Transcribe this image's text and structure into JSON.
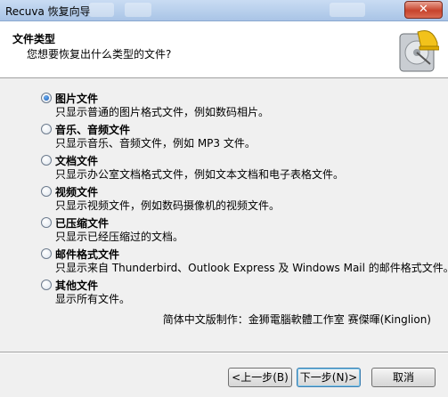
{
  "window": {
    "title": "Recuva 恢复向导",
    "close_label": "✕"
  },
  "header": {
    "title": "文件类型",
    "subtitle": "您想要恢复出什么类型的文件?"
  },
  "options": [
    {
      "label": "图片文件",
      "desc": "只显示普通的图片格式文件，例如数码相片。",
      "checked": true
    },
    {
      "label": "音乐、音频文件",
      "desc": "只显示音乐、音频文件，例如 MP3 文件。",
      "checked": false
    },
    {
      "label": "文档文件",
      "desc": "只显示办公室文档格式文件，例如文本文档和电子表格文件。",
      "checked": false
    },
    {
      "label": "视频文件",
      "desc": "只显示视频文件，例如数码摄像机的视频文件。",
      "checked": false
    },
    {
      "label": "已压缩文件",
      "desc": "只显示已经压缩过的文档。",
      "checked": false
    },
    {
      "label": "邮件格式文件",
      "desc": "只显示来自 Thunderbird、Outlook Express 及 Windows Mail 的邮件格式文件。",
      "checked": false
    },
    {
      "label": "其他文件",
      "desc": "显示所有文件。",
      "checked": false
    }
  ],
  "credit": "简体中文版制作：金狮電腦軟體工作室 赛傑暉(Kinglion)",
  "buttons": {
    "back": "<上一步(B)",
    "next": "下一步(N)>",
    "cancel": "取消"
  },
  "colors": {
    "accent": "#1457b6",
    "titlebar": "#a9c4e6"
  }
}
